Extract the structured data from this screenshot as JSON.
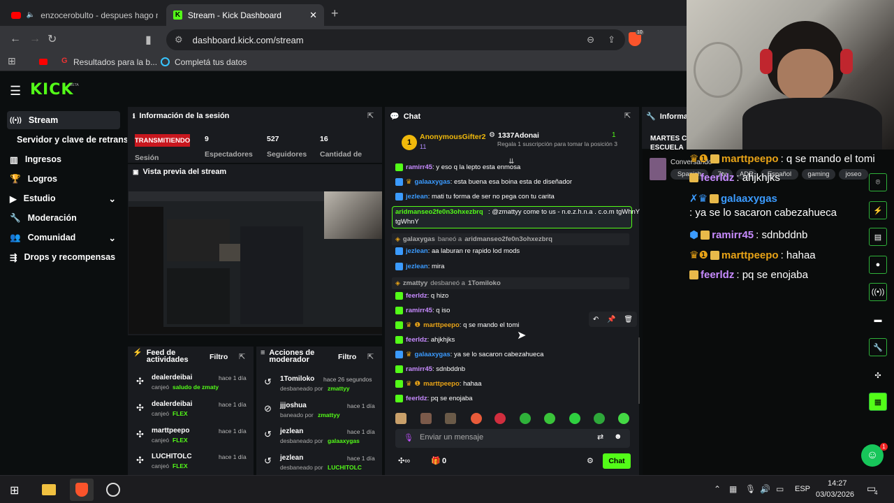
{
  "browser": {
    "tabs": [
      {
        "label": "enzocerobulto - despues hago m"
      },
      {
        "label": "Stream - Kick Dashboard"
      }
    ],
    "url": "dashboard.kick.com/stream",
    "bookmarks": [
      {
        "label": "Resultados para la b..."
      },
      {
        "label": "Completá tus datos"
      }
    ],
    "shield_count": "10"
  },
  "kick": {
    "logo": "KICK",
    "logo_badge": "BETA",
    "sidebar": [
      {
        "label": "Stream"
      },
      {
        "label": "Servidor y clave de retransm"
      },
      {
        "label": "Ingresos"
      },
      {
        "label": "Logros"
      },
      {
        "label": "Estudio"
      },
      {
        "label": "Moderación"
      },
      {
        "label": "Comunidad"
      },
      {
        "label": "Drops y recompensas"
      }
    ],
    "session": {
      "title": "Información de la sesión",
      "status": "TRANSMITIENDO",
      "status_sub": "Sesión",
      "stats": [
        {
          "value": "9",
          "label": "Espectadores"
        },
        {
          "value": "527",
          "label": "Seguidores"
        },
        {
          "value": "16",
          "label": "Cantidad de"
        }
      ]
    },
    "preview_title": "Vista previa del stream",
    "activity": {
      "title": "Feed de actividades",
      "filter": "Filtro",
      "items": [
        {
          "user": "dealerdeibai",
          "time": "hace 1 día",
          "action": "canjeó",
          "item": "saludo de zmaty"
        },
        {
          "user": "dealerdeibai",
          "time": "hace 1 día",
          "action": "canjeó",
          "item": "FLEX"
        },
        {
          "user": "marttpeepo",
          "time": "hace 1 día",
          "action": "canjeó",
          "item": "FLEX"
        },
        {
          "user": "LUCHITOLC",
          "time": "hace 1 día",
          "action": "canjeó",
          "item": "FLEX"
        }
      ]
    },
    "modactions": {
      "title": "Acciones de moderador",
      "filter": "Filtro",
      "items": [
        {
          "user": "1Tomiloko",
          "time": "hace 26 segundos",
          "action": "desbaneado por",
          "by": "zmattyy"
        },
        {
          "user": "jjjoshua",
          "time": "hace 1 día",
          "action": "baneado por",
          "by": "zmattyy"
        },
        {
          "user": "jezlean",
          "time": "hace 1 día",
          "action": "desbaneado por",
          "by": "galaaxygas"
        },
        {
          "user": "jezlean",
          "time": "hace 1 día",
          "action": "desbaneado por",
          "by": "LUCHITOLC"
        }
      ]
    },
    "chat": {
      "title": "Chat",
      "top_gifter": {
        "name": "AnonymousGifter2",
        "count": "11",
        "rank": "1"
      },
      "gift_user": "1337Adonai",
      "gift_count": "1",
      "gift_text": "Regala 1 suscripción para tomar la posición 3",
      "messages": [
        {
          "user": "ramirr45",
          "text": ": y eso q la lepto esta enmosa"
        },
        {
          "user": "galaaxygas",
          "text": ": esta buena esa boina esta de diseñador"
        },
        {
          "user": "jezlean",
          "text": ": mati tu forma de ser no pega con tu carita"
        },
        {
          "user": "aridmanseo2fe0n3ohxezbrq",
          "text": ": @zmattyy come to us - n.e.z.h.n.a . c.o.m tgWhnY"
        },
        {
          "user": "galaxygas",
          "text": "baneó a",
          "target": "aridmanseo2fe0n3ohxezbrq"
        },
        {
          "user": "jezlean",
          "text": ": aa laburan re rapido lod mods"
        },
        {
          "user": "jezlean",
          "text": ": mira"
        },
        {
          "user": "zmattyy",
          "text": "desbaneó a",
          "target": "1Tomiloko"
        },
        {
          "user": "feerldz",
          "text": ": q hizo"
        },
        {
          "user": "ramirr45",
          "text": ": q iso"
        },
        {
          "user": "marttpeepo",
          "text": ": q se mando el tomi"
        },
        {
          "user": "feerldz",
          "text": ": ahjkhjks"
        },
        {
          "user": "galaaxygas",
          "text": ": ya se lo sacaron cabezahueca"
        },
        {
          "user": "ramirr45",
          "text": ": sdnbddnb"
        },
        {
          "user": "marttpeepo",
          "text": ": hahaa"
        },
        {
          "user": "feerldz",
          "text": ": pq se enojaba"
        }
      ],
      "input_placeholder": "Enviar un mensaje",
      "points": "0",
      "send": "Chat"
    },
    "info_title": "Informac",
    "stream_title_partial": "MARTES C ESCUELA S",
    "stream_category": "Conversando",
    "tags": [
      "Spanish",
      "7tv",
      "ADR",
      "Español",
      "gaming",
      "joseo"
    ]
  },
  "overlay_chat": [
    {
      "user": "marttpeepo",
      "text": ": q se mando el tomi"
    },
    {
      "user": "feerldz",
      "text": ": ahjkhjks"
    },
    {
      "user": "galaaxygas",
      "text": ": ya se lo sacaron cabezahueca"
    },
    {
      "user": "ramirr45",
      "text": ": sdnbddnb"
    },
    {
      "user": "marttpeepo",
      "text": ": hahaa"
    },
    {
      "user": "feerldz",
      "text": ": pq se enojaba"
    }
  ],
  "taskbar": {
    "lang": "ESP",
    "time": "14:27",
    "date": "03/03/2026",
    "notif": "4"
  },
  "colors": {
    "kick_green": "#53fc18",
    "gold": "#e8a317",
    "blue": "#3b9bff",
    "purple": "#c78bff"
  }
}
